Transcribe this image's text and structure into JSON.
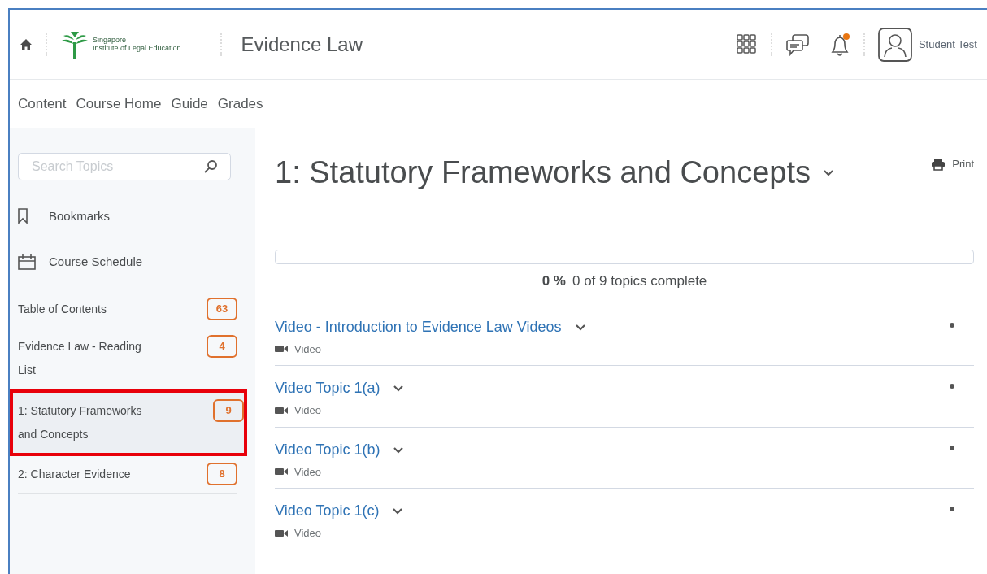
{
  "header": {
    "logo_text": [
      "Singapore",
      "Institute of Legal Education"
    ],
    "course_title": "Evidence Law",
    "notifications_unread": true,
    "user_name": "Student Test"
  },
  "nav": [
    "Content",
    "Course Home",
    "Guide",
    "Grades"
  ],
  "sidebar": {
    "search": {
      "placeholder": "Search Topics"
    },
    "links": [
      {
        "kind": "bookmark",
        "label": "Bookmarks"
      },
      {
        "kind": "calendar",
        "label": "Course Schedule"
      }
    ],
    "modules": [
      {
        "label": "Table of Contents",
        "count": "63",
        "selected": false
      },
      {
        "label": "Evidence Law - Reading List",
        "count": "4",
        "selected": false
      },
      {
        "label": "1: Statutory Frameworks and Concepts",
        "count": "9",
        "selected": true
      },
      {
        "label": "2: Character Evidence",
        "count": "8",
        "selected": false
      }
    ]
  },
  "main": {
    "title": "1: Statutory Frameworks and Concepts",
    "print": "Print",
    "progress": {
      "level": 0,
      "percent": "0 %",
      "summary": "0 of 9 topics complete"
    },
    "topics": [
      {
        "title": "Video - Introduction to Evidence Law Videos",
        "type": "Video"
      },
      {
        "title": "Video Topic 1(a)",
        "type": "Video"
      },
      {
        "title": "Video Topic 1(b)",
        "type": "Video"
      },
      {
        "title": "Video Topic 1(c)",
        "type": "Video"
      }
    ]
  }
}
